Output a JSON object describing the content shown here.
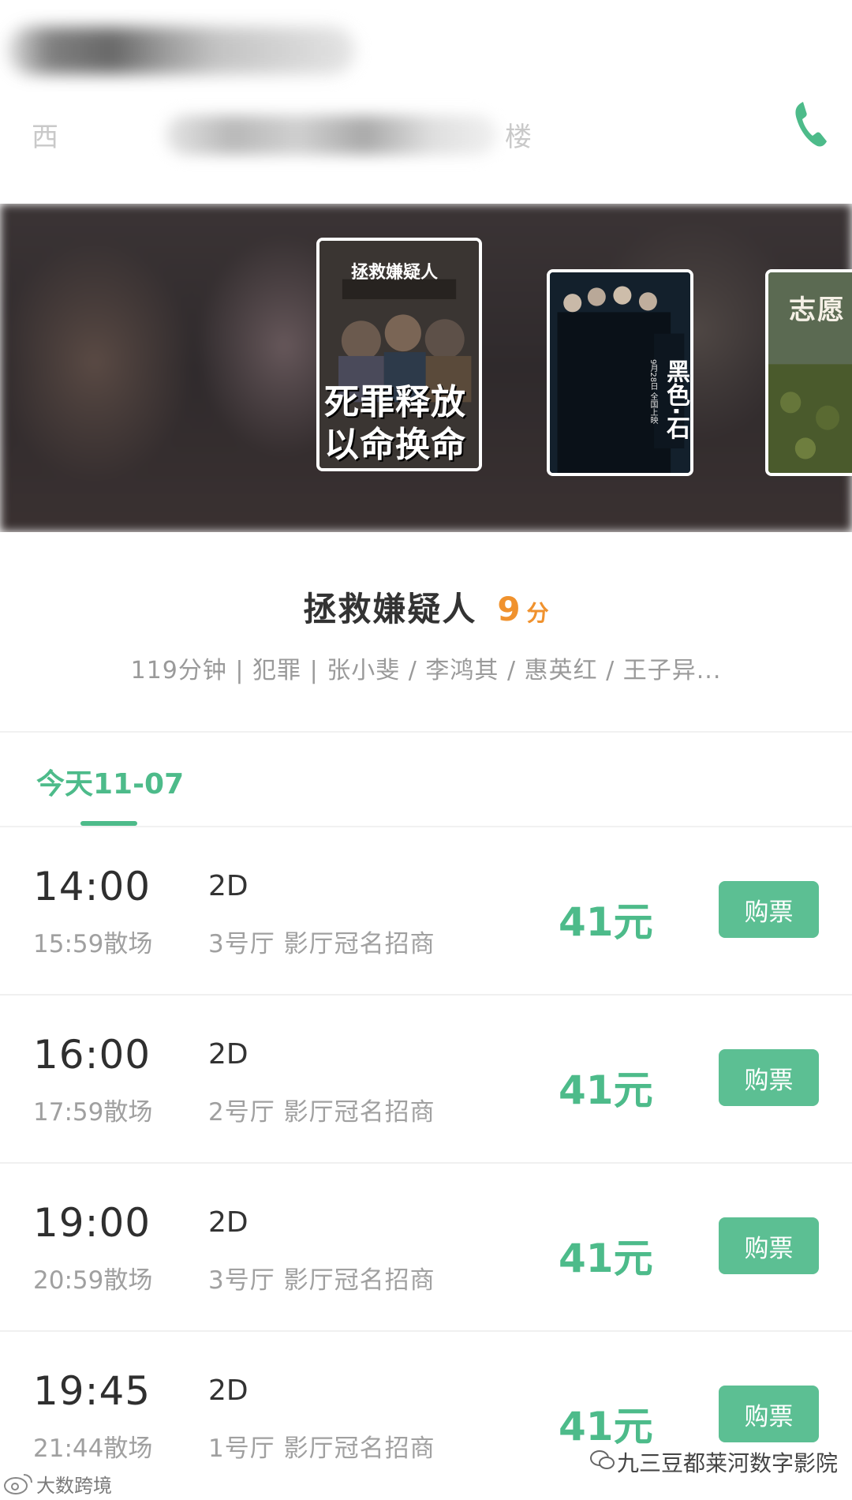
{
  "header": {
    "address_visible": "西",
    "address_suffix": "楼",
    "phone_icon": "phone-icon"
  },
  "banner": {
    "posters": [
      {
        "title": "拯救嫌疑人",
        "tagline_line1": "死罪释放",
        "tagline_line2": "以命换命",
        "selected": true
      },
      {
        "title": "黑色·石",
        "release": "9月28日 全国上映",
        "selected": false
      },
      {
        "title": "志愿",
        "selected": false
      }
    ]
  },
  "movie": {
    "title": "拯救嫌疑人",
    "score": "9",
    "score_unit": "分",
    "meta": "119分钟 | 犯罪 | 张小斐 / 李鸿其 / 惠英红 / 王子异..."
  },
  "date_tabs": [
    {
      "label": "今天11-07",
      "active": true
    }
  ],
  "sessions": [
    {
      "start": "14:00",
      "end": "15:59散场",
      "format": "2D",
      "hall": "3号厅 影厅冠名招商",
      "price": "41元",
      "button": "购票"
    },
    {
      "start": "16:00",
      "end": "17:59散场",
      "format": "2D",
      "hall": "2号厅 影厅冠名招商",
      "price": "41元",
      "button": "购票"
    },
    {
      "start": "19:00",
      "end": "20:59散场",
      "format": "2D",
      "hall": "3号厅 影厅冠名招商",
      "price": "41元",
      "button": "购票"
    },
    {
      "start": "19:45",
      "end": "21:44散场",
      "format": "2D",
      "hall": "1号厅 影厅冠名招商",
      "price": "41元",
      "button": "购票"
    }
  ],
  "watermarks": {
    "left": "大数跨境",
    "right": "九三豆都莱河数字影院"
  },
  "colors": {
    "accent_green": "#4dbb8a",
    "button_green": "#5cbf93",
    "score_orange": "#f0922e",
    "title_text": "#333333",
    "secondary_text": "#a0a0a0"
  }
}
